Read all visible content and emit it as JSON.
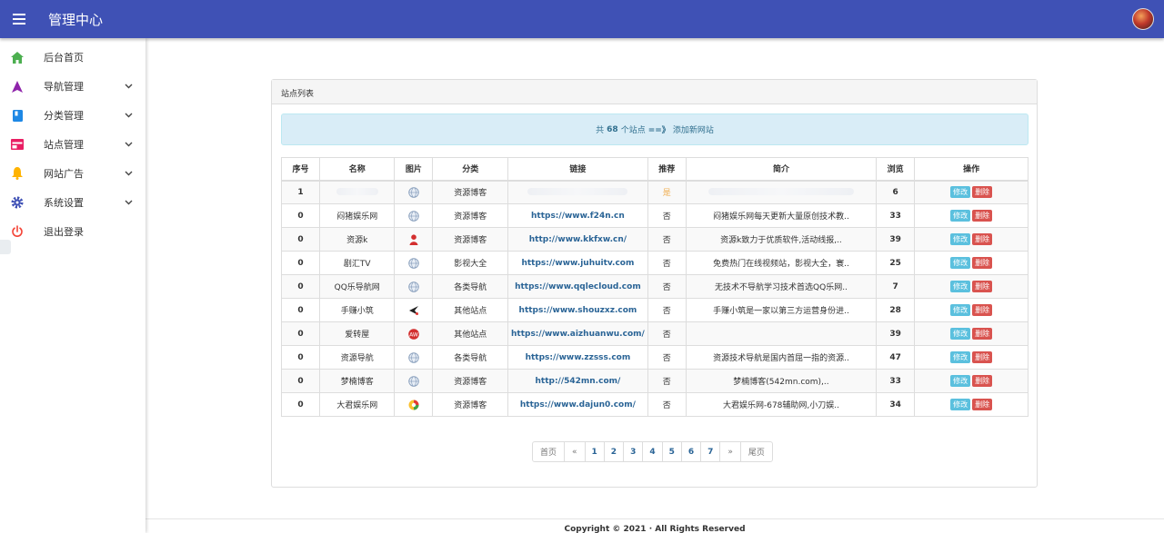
{
  "app": {
    "title": "管理中心"
  },
  "sidebar": {
    "items": [
      {
        "label": "后台首页",
        "icon": "home-icon",
        "color": "#4caf50",
        "expandable": false
      },
      {
        "label": "导航管理",
        "icon": "navigation-arrow-icon",
        "color": "#8e24aa",
        "expandable": true
      },
      {
        "label": "分类管理",
        "icon": "book-icon",
        "color": "#1e88e5",
        "expandable": true
      },
      {
        "label": "站点管理",
        "icon": "window-icon",
        "color": "#e91e63",
        "expandable": true
      },
      {
        "label": "网站广告",
        "icon": "bell-icon",
        "color": "#ffb300",
        "expandable": true
      },
      {
        "label": "系统设置",
        "icon": "gear-icon",
        "color": "#3f51b5",
        "expandable": true
      },
      {
        "label": "退出登录",
        "icon": "power-icon",
        "color": "#f44336",
        "expandable": false
      }
    ]
  },
  "panel": {
    "title": "站点列表",
    "info": {
      "prefix": "共",
      "count": "68",
      "suffix": "个站点",
      "arrow": "==》",
      "add_link": "添加新网站"
    }
  },
  "table": {
    "headers": [
      "序号",
      "名称",
      "图片",
      "分类",
      "链接",
      "推荐",
      "简介",
      "浏览",
      "操作"
    ],
    "rows": [
      {
        "idx": "1",
        "name": "",
        "icon": "globe-icon",
        "category": "资源博客",
        "url": "",
        "recommend": "是",
        "intro": "",
        "views": "6",
        "blurred": true
      },
      {
        "idx": "0",
        "name": "闷猪娱乐网",
        "icon": "globe-icon",
        "category": "资源博客",
        "url": "https://www.f24n.cn",
        "recommend": "否",
        "intro": "闷猪娱乐网每天更新大量原创技术教..",
        "views": "33"
      },
      {
        "idx": "0",
        "name": "资源k",
        "icon": "red-figure-icon",
        "category": "资源博客",
        "url": "http://www.kkfxw.cn/",
        "recommend": "否",
        "intro": "资源k致力于优质软件,活动线报,..",
        "views": "39"
      },
      {
        "idx": "0",
        "name": "剧汇TV",
        "icon": "globe-icon",
        "category": "影视大全",
        "url": "https://www.juhuitv.com",
        "recommend": "否",
        "intro": "免费热门在线视频站，影视大全，寰..",
        "views": "25"
      },
      {
        "idx": "0",
        "name": "QQ乐导航网",
        "icon": "globe-icon",
        "category": "各类导航",
        "url": "https://www.qqlecloud.com",
        "recommend": "否",
        "intro": "无技术不导航学习技术首选QQ乐网..",
        "views": "7"
      },
      {
        "idx": "0",
        "name": "手赚小筑",
        "icon": "arrow-logo-icon",
        "category": "其他站点",
        "url": "https://www.shouzxz.com",
        "recommend": "否",
        "intro": "手赚小筑是一家以第三方运营身份进..",
        "views": "28"
      },
      {
        "idx": "0",
        "name": "爱转屋",
        "icon": "red-logo-icon",
        "category": "其他站点",
        "url": "https://www.aizhuanwu.com/",
        "recommend": "否",
        "intro": "",
        "views": "39"
      },
      {
        "idx": "0",
        "name": "资源导航",
        "icon": "globe-icon",
        "category": "各类导航",
        "url": "https://www.zzsss.com",
        "recommend": "否",
        "intro": "资源技术导航是国内首屈一指的资源..",
        "views": "47"
      },
      {
        "idx": "0",
        "name": "梦楠博客",
        "icon": "globe-icon",
        "category": "资源博客",
        "url": "http://542mn.com/",
        "recommend": "否",
        "intro": "梦楠博客(542mn.com),..",
        "views": "33"
      },
      {
        "idx": "0",
        "name": "大君娱乐网",
        "icon": "colorful-circle-icon",
        "category": "资源博客",
        "url": "https://www.dajun0.com/",
        "recommend": "否",
        "intro": "大君娱乐网-678辅助网,小刀娱..",
        "views": "34"
      }
    ],
    "actions": {
      "edit": "修改",
      "delete": "删除"
    }
  },
  "pagination": {
    "first": "首页",
    "prev": "«",
    "pages": [
      "1",
      "2",
      "3",
      "4",
      "5",
      "6",
      "7"
    ],
    "next": "»",
    "last": "尾页"
  },
  "footer": {
    "text": "Copyright © 2021 ·           All Rights Reserved"
  },
  "colors": {
    "topbar": "#3f51b5",
    "info_bg": "#d9edf7",
    "edit": "#5bc0de",
    "delete": "#d9534f",
    "link": "#2a6496"
  }
}
